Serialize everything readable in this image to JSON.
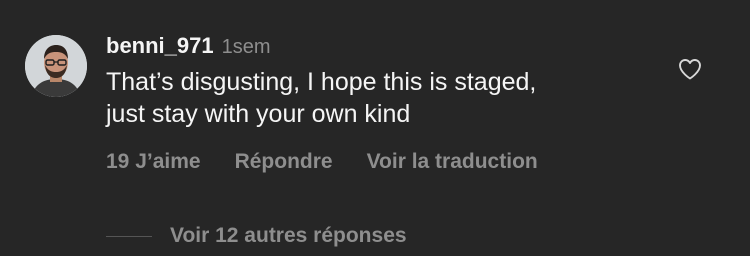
{
  "comment": {
    "username": "benni_971",
    "time": "1sem",
    "text_lines": [
      "That’s disgusting, I hope this is staged,",
      "just stay with your own kind"
    ],
    "likes": "19 J’aime",
    "reply_label": "Répondre",
    "translate_label": "Voir la traduction",
    "view_replies_label": "Voir 12 autres réponses",
    "like_icon": "heart-outline-icon"
  },
  "colors": {
    "background": "#262626",
    "primary_text": "#f5f5f5",
    "secondary_text": "#8e8e8e"
  }
}
